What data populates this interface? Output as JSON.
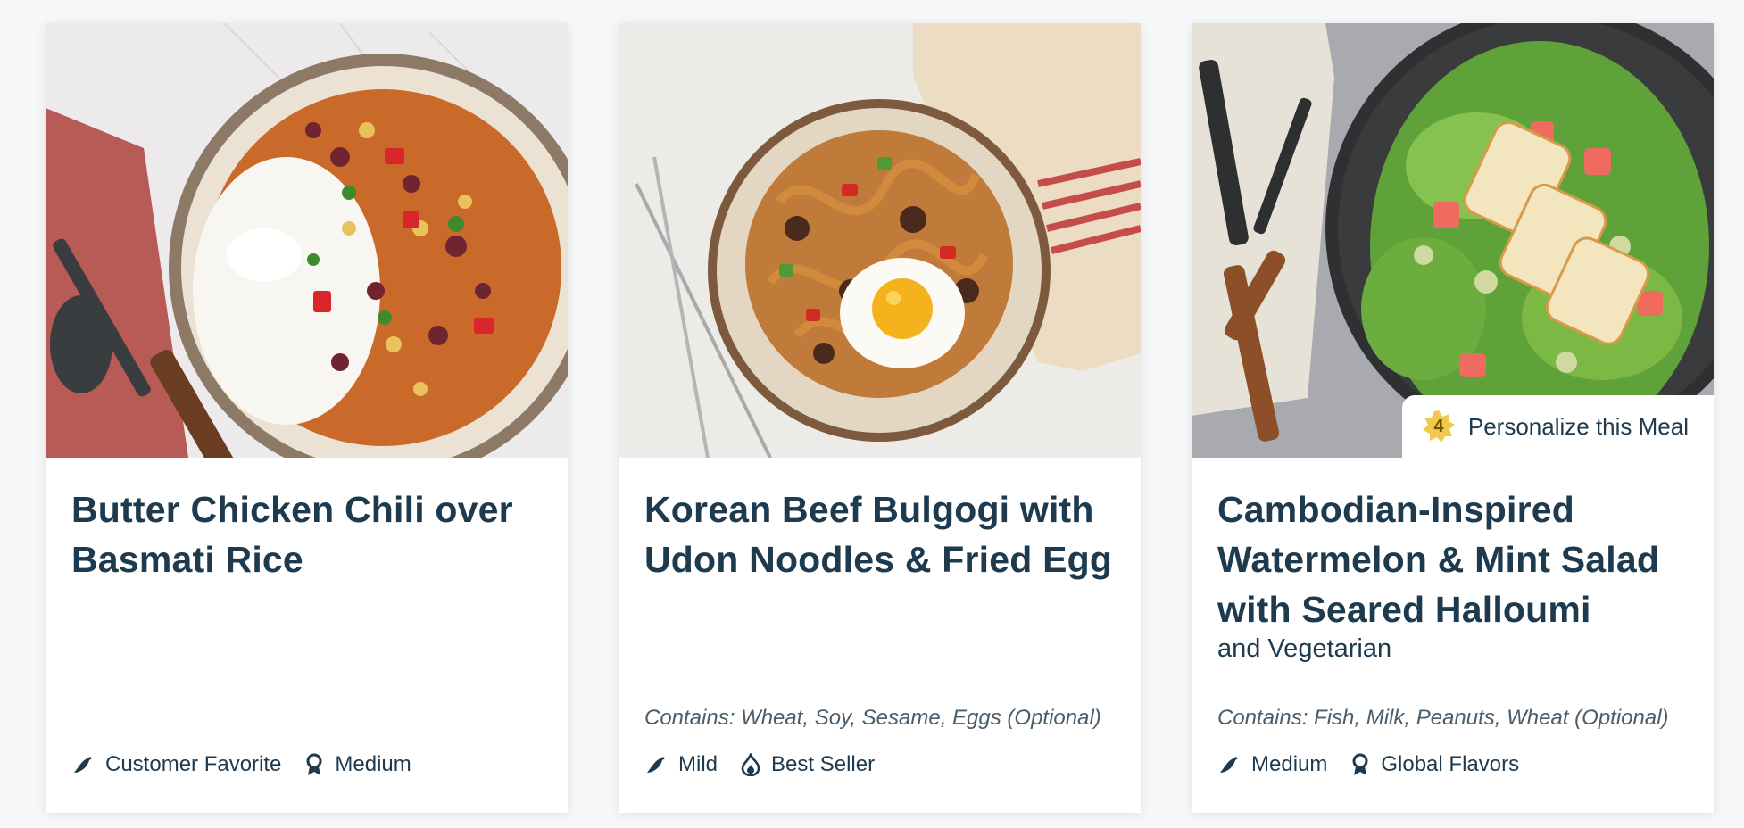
{
  "cards": [
    {
      "title": "Butter Chicken Chili over Basmati Rice",
      "subtitle": "",
      "contains": "",
      "tags": [
        {
          "icon": "chili-pepper-icon",
          "label": "Customer Favorite"
        },
        {
          "icon": "award-ribbon-icon",
          "label": "Medium"
        }
      ]
    },
    {
      "title": "Korean Beef Bulgogi with Udon Noodles & Fried Egg",
      "subtitle": "",
      "contains": "Contains: Wheat, Soy, Sesame, Eggs (Optional)",
      "tags": [
        {
          "icon": "chili-pepper-icon",
          "label": "Mild"
        },
        {
          "icon": "flame-icon",
          "label": "Best Seller"
        }
      ]
    },
    {
      "title": "Cambodian-Inspired Watermelon & Mint Salad with Seared Halloumi",
      "subtitle": "and Vegetarian",
      "contains": "Contains: Fish, Milk, Peanuts, Wheat (Optional)",
      "tags": [
        {
          "icon": "chili-pepper-icon",
          "label": "Medium"
        },
        {
          "icon": "award-ribbon-icon",
          "label": "Global Flavors"
        }
      ],
      "personalize": {
        "count": "4",
        "label": "Personalize this Meal"
      }
    }
  ],
  "colors": {
    "text": "#1d3a4e",
    "muted": "#4a5d6b",
    "badge": "#f2c94c"
  }
}
